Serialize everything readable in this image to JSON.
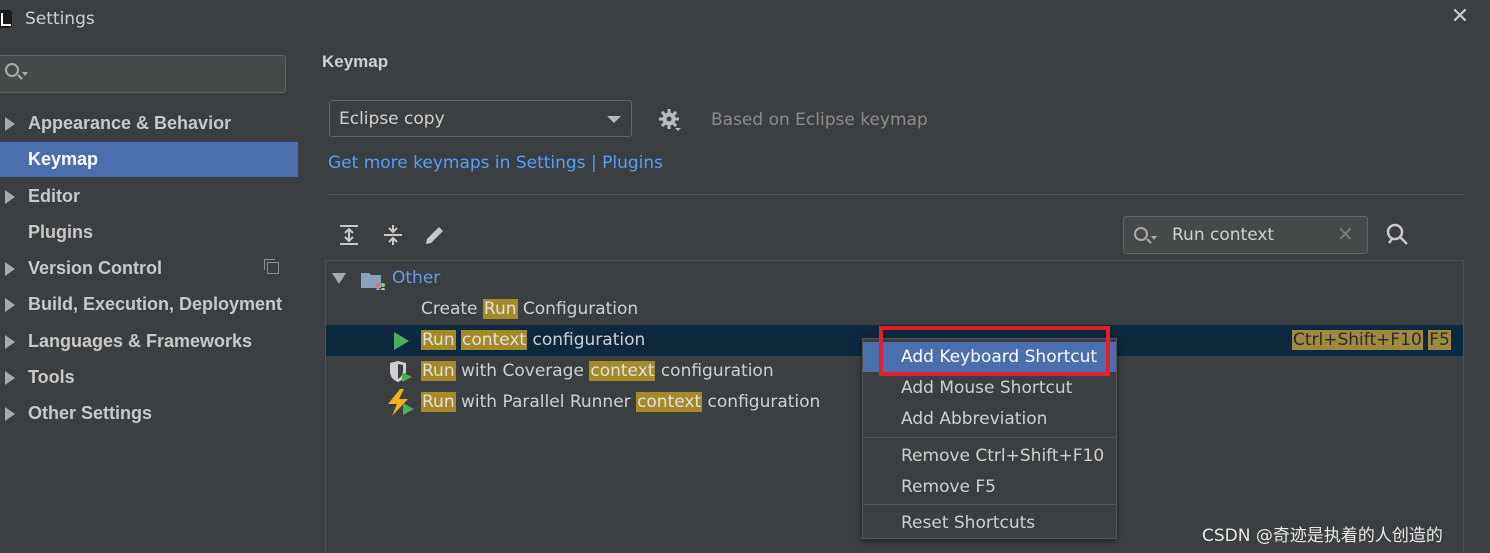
{
  "window": {
    "title": "Settings"
  },
  "sidebar": {
    "search": {
      "value": ""
    },
    "items": [
      {
        "label": "Appearance & Behavior",
        "expandable": true
      },
      {
        "label": "Keymap",
        "expandable": false,
        "selected": true
      },
      {
        "label": "Editor",
        "expandable": true
      },
      {
        "label": "Plugins",
        "expandable": false
      },
      {
        "label": "Version Control",
        "expandable": true
      },
      {
        "label": "Build, Execution, Deployment",
        "expandable": true
      },
      {
        "label": "Languages & Frameworks",
        "expandable": true
      },
      {
        "label": "Tools",
        "expandable": true
      },
      {
        "label": "Other Settings",
        "expandable": true
      }
    ]
  },
  "main": {
    "title": "Keymap",
    "keymap_select": {
      "value": "Eclipse copy"
    },
    "based_on": "Based on Eclipse keymap",
    "link": "Get more keymaps in Settings | Plugins",
    "search": {
      "value": "Run context"
    }
  },
  "tree": {
    "group": "Other",
    "rows": [
      {
        "parts": [
          "Create ",
          "Run",
          " Configuration"
        ]
      },
      {
        "parts": [
          "Run",
          " ",
          "context",
          " configuration"
        ],
        "shortcuts": [
          "Ctrl+Shift+F10",
          "F5"
        ]
      },
      {
        "parts": [
          "Run",
          " with Coverage ",
          "context",
          " configuration"
        ]
      },
      {
        "parts": [
          "Run",
          " with Parallel Runner ",
          "context",
          " configuration"
        ]
      }
    ]
  },
  "context_menu": {
    "items": [
      "Add Keyboard Shortcut",
      "Add Mouse Shortcut",
      "Add Abbreviation",
      "Remove Ctrl+Shift+F10",
      "Remove F5",
      "Reset Shortcuts"
    ]
  },
  "watermark": "CSDN @奇迹是执着的人创造的",
  "colors": {
    "background": "#3c3f41",
    "selection": "#4b6eaf",
    "tree_selection": "#0d293e",
    "link": "#589df6",
    "search_highlight": "#a58a2a",
    "annotation_box": "#e0202a"
  }
}
